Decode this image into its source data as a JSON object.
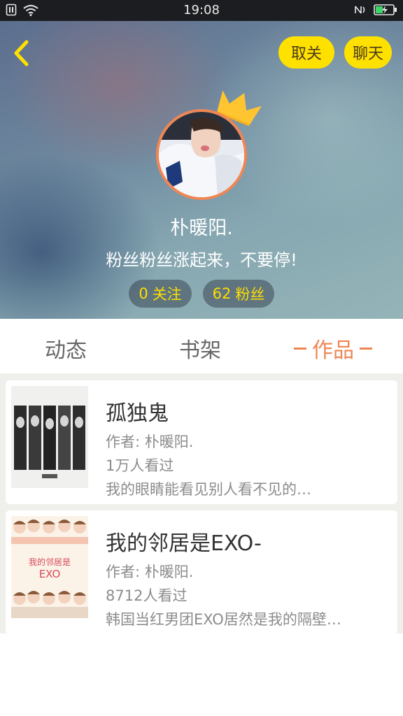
{
  "status_bar": {
    "time": "19:08",
    "left_icons": [
      "sim-icon",
      "wifi-icon"
    ],
    "right_icons": [
      "nfc-icon",
      "battery-charging-icon"
    ]
  },
  "header": {
    "back_icon": "chevron-left-icon",
    "unfollow_label": "取关",
    "chat_label": "聊天",
    "accent_color": "#ffe100"
  },
  "profile": {
    "name": "朴暖阳.",
    "bio": "粉丝粉丝涨起来，不要停!",
    "following_count": "0",
    "following_label": "关注",
    "fans_count": "62",
    "fans_label": "粉丝",
    "avatar_border_color": "#ef8654",
    "crown_color": "#ffc531"
  },
  "tabs": {
    "items": [
      "动态",
      "书架",
      "作品"
    ],
    "active": "作品",
    "active_color": "#ef8654"
  },
  "works": [
    {
      "title": "孤独鬼",
      "author": "作者: 朴暖阳.",
      "views": "1万人看过",
      "description": "我的眼睛能看见别人看不见的…"
    },
    {
      "title": "我的邻居是EXO-",
      "author": "作者: 朴暖阳.",
      "views": "8712人看过",
      "description": "韩国当红男团EXO居然是我的隔壁…",
      "cover_text_line1": "我的邻居是",
      "cover_text_line2": "EXO"
    }
  ]
}
